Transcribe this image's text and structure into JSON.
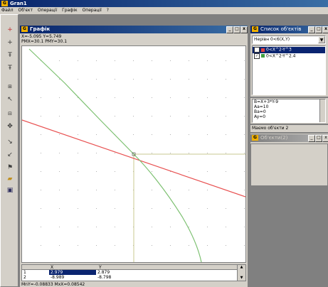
{
  "app": {
    "title": "Gran1"
  },
  "menu": [
    "Файл",
    "Об'єкт",
    "Операції",
    "Графік",
    "Операції",
    "?"
  ],
  "toolbar_icons": [
    "plus-icon",
    "plus-icon",
    "pi-icon",
    "pi-icon",
    "ruler-icon",
    "cursor-icon",
    "ruler-icon",
    "move-icon",
    "tool-icon",
    "tool-icon",
    "flag-icon",
    "folder-icon",
    "save-icon"
  ],
  "graph_window": {
    "title": "Графік",
    "coords": "X=-5.095  Y=5.749",
    "scale": "PMX=30.1  PMY=30.1",
    "axes": {
      "x_range": [
        -6,
        4
      ],
      "y_range": [
        -7,
        7
      ]
    }
  },
  "table": {
    "headers": [
      "",
      "X",
      "Y"
    ],
    "rows": [
      {
        "n": "1",
        "x": "2.979",
        "y": "2.879"
      },
      {
        "n": "2",
        "x": "-8.989",
        "y": "-8.798"
      }
    ],
    "footer": "MnY=-0.08833  MxX=0.08542"
  },
  "objects_window": {
    "title": "Список об'єктів",
    "select_value": "Нерівн 0<6(X,Y)",
    "items": [
      {
        "label": "0<X^2-Y^3",
        "checked": true,
        "color": "#e04040",
        "selected": true
      },
      {
        "label": "0<X^2-Y^2.4",
        "checked": true,
        "color": "#40a040",
        "selected": false
      }
    ]
  },
  "props": {
    "lines": [
      "B=X+3*Y-9",
      "Aa=10",
      "Ba=0",
      "Ay=0"
    ]
  },
  "inactive_section_label": "Маємо об'єкти 2",
  "inactive_window": {
    "title": "Об'єкти(2)"
  },
  "colors": {
    "red_line": "#e85050",
    "green_curve": "#7cc070",
    "crosshair": "#c8c890"
  }
}
